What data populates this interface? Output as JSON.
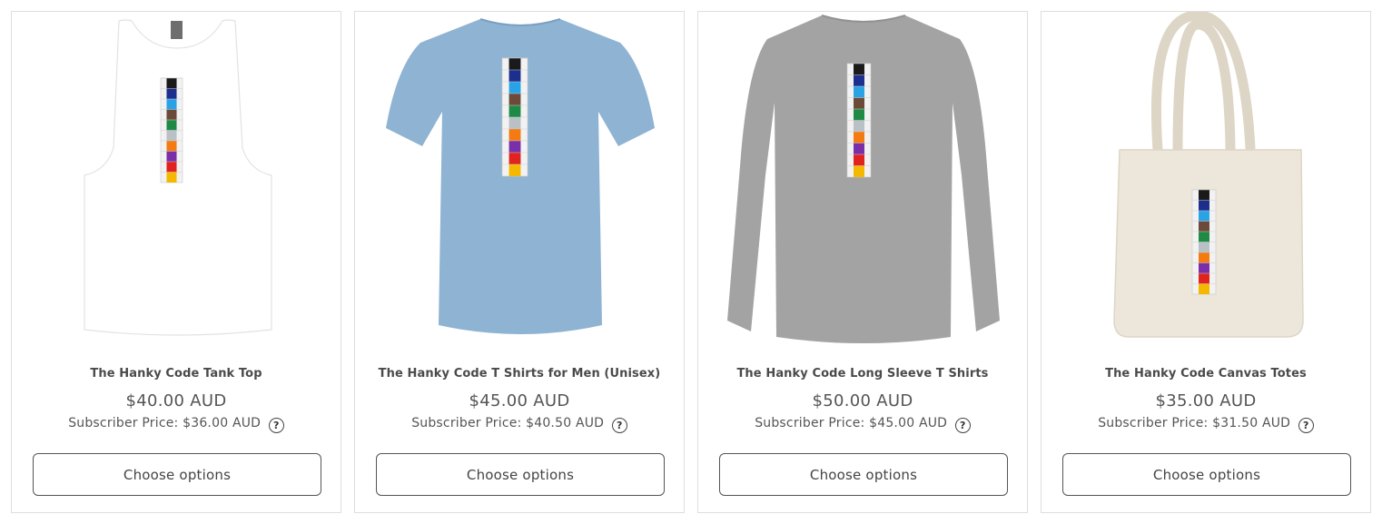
{
  "products": [
    {
      "title": "The Hanky Code Tank Top",
      "price": "$40.00 AUD",
      "subscriber_label": "Subscriber Price:",
      "subscriber_price": "$36.00 AUD",
      "help": "?",
      "button": "Choose options",
      "image_icon": "tank-top-icon",
      "garment_color": "#ffffff"
    },
    {
      "title": "The Hanky Code T Shirts for Men (Unisex)",
      "price": "$45.00 AUD",
      "subscriber_label": "Subscriber Price:",
      "subscriber_price": "$40.50 AUD",
      "help": "?",
      "button": "Choose options",
      "image_icon": "t-shirt-icon",
      "garment_color": "#8fb3d3"
    },
    {
      "title": "The Hanky Code Long Sleeve T Shirts",
      "price": "$50.00 AUD",
      "subscriber_label": "Subscriber Price:",
      "subscriber_price": "$45.00 AUD",
      "help": "?",
      "button": "Choose options",
      "image_icon": "long-sleeve-shirt-icon",
      "garment_color": "#a3a3a3"
    },
    {
      "title": "The Hanky Code Canvas Totes",
      "price": "$35.00 AUD",
      "subscriber_label": "Subscriber Price:",
      "subscriber_price": "$31.50 AUD",
      "help": "?",
      "button": "Choose options",
      "image_icon": "tote-bag-icon",
      "garment_color": "#ece7da"
    }
  ],
  "hanky_colors": [
    "#1a1a1a",
    "#1d2f8c",
    "#2aa3e6",
    "#6b4a3a",
    "#1e8a45",
    "#b9c0c6",
    "#f47a12",
    "#7a2fa8",
    "#e0231e",
    "#f5b800"
  ]
}
